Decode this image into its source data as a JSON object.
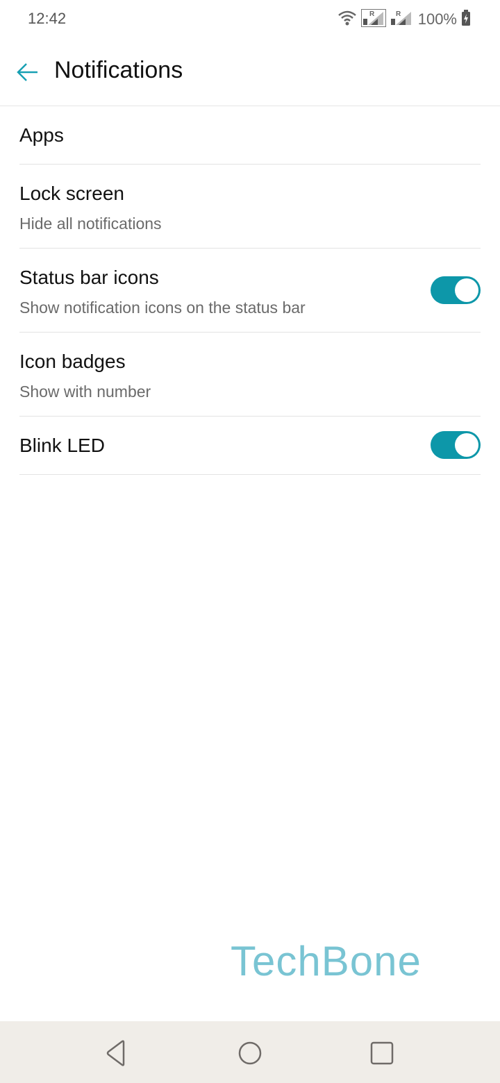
{
  "status_bar": {
    "time": "12:42",
    "battery_percent": "100%",
    "icons": [
      "wifi-icon",
      "signal-sim1-icon",
      "signal-sim2-icon",
      "battery-charging-icon"
    ],
    "sim_roaming_label": "R"
  },
  "app_bar": {
    "title": "Notifications",
    "back_icon": "arrow-left-icon"
  },
  "colors": {
    "accent": "#0d97a9",
    "watermark": "#79c4d3",
    "nav_bar_bg": "#f0ede8"
  },
  "settings": [
    {
      "title": "Apps"
    },
    {
      "title": "Lock screen",
      "subtitle": "Hide all notifications"
    },
    {
      "title": "Status bar icons",
      "subtitle": "Show notification icons on the status bar",
      "toggle": true
    },
    {
      "title": "Icon badges",
      "subtitle": "Show with number"
    },
    {
      "title": "Blink LED",
      "toggle": true
    }
  ],
  "watermark": "TechBone",
  "nav_bar": {
    "buttons": [
      "back",
      "home",
      "recents"
    ]
  }
}
